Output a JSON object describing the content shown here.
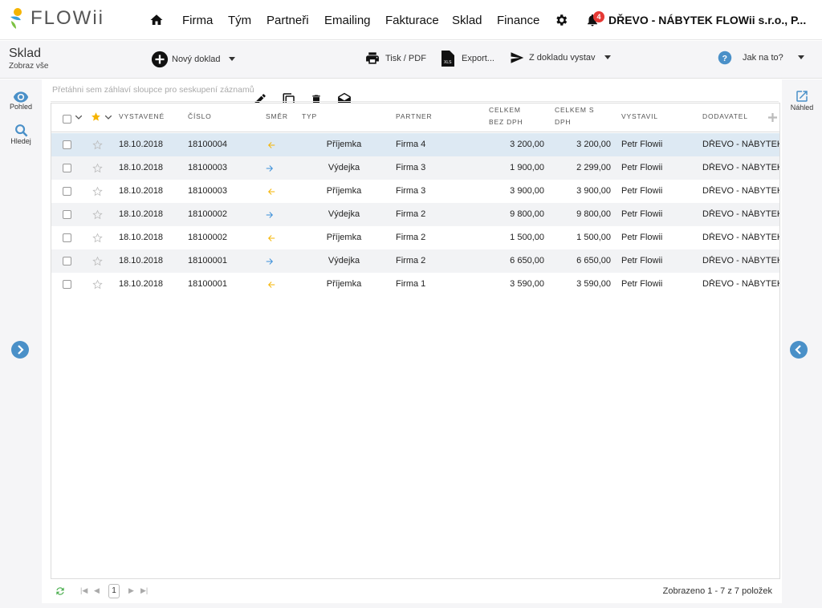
{
  "brand": {
    "name": "FLOWii"
  },
  "nav": {
    "items": [
      "Firma",
      "Tým",
      "Partneři",
      "Emailing",
      "Fakturace",
      "Sklad",
      "Finance"
    ],
    "notification_count": "4",
    "company": "DŘEVO - NÁBYTEK FLOWii s.r.o., P..."
  },
  "page": {
    "title": "Sklad",
    "subtitle": "Zobraz vše"
  },
  "toolbar": {
    "new_doc": "Nový doklad",
    "print": "Tisk / PDF",
    "export": "Export...",
    "from_doc": "Z dokladu vystav",
    "help": "Jak na to?"
  },
  "left_sidebar": {
    "view": "Pohled",
    "search": "Hledej"
  },
  "right_sidebar": {
    "preview": "Náhled"
  },
  "grid": {
    "group_hint": "Přetáhni sem záhlaví sloupce pro seskupení záznamů",
    "columns": {
      "issued": "VYSTAVENÉ",
      "number": "ČÍSLO",
      "direction": "SMĚR",
      "type": "TYP",
      "partner": "PARTNER",
      "total_no_vat_1": "CELKEM",
      "total_no_vat_2": "BEZ DPH",
      "total_vat_1": "CELKEM S",
      "total_vat_2": "DPH",
      "issued_by": "VYSTAVIL",
      "supplier": "DODAVATEL"
    },
    "rows": [
      {
        "date": "18.10.2018",
        "number": "18100004",
        "dir": "in",
        "type": "Příjemka",
        "partner": "Firma 4",
        "total": "3 200,00",
        "total_vat": "3 200,00",
        "by": "Petr Flowii",
        "supplier": "DŘEVO - NÁBYTEK F"
      },
      {
        "date": "18.10.2018",
        "number": "18100003",
        "dir": "out",
        "type": "Výdejka",
        "partner": "Firma 3",
        "total": "1 900,00",
        "total_vat": "2 299,00",
        "by": "Petr Flowii",
        "supplier": "DŘEVO - NÁBYTEK F"
      },
      {
        "date": "18.10.2018",
        "number": "18100003",
        "dir": "in",
        "type": "Příjemka",
        "partner": "Firma 3",
        "total": "3 900,00",
        "total_vat": "3 900,00",
        "by": "Petr Flowii",
        "supplier": "DŘEVO - NÁBYTEK F"
      },
      {
        "date": "18.10.2018",
        "number": "18100002",
        "dir": "out",
        "type": "Výdejka",
        "partner": "Firma 2",
        "total": "9 800,00",
        "total_vat": "9 800,00",
        "by": "Petr Flowii",
        "supplier": "DŘEVO - NÁBYTEK F"
      },
      {
        "date": "18.10.2018",
        "number": "18100002",
        "dir": "in",
        "type": "Příjemka",
        "partner": "Firma 2",
        "total": "1 500,00",
        "total_vat": "1 500,00",
        "by": "Petr Flowii",
        "supplier": "DŘEVO - NÁBYTEK F"
      },
      {
        "date": "18.10.2018",
        "number": "18100001",
        "dir": "out",
        "type": "Výdejka",
        "partner": "Firma 2",
        "total": "6 650,00",
        "total_vat": "6 650,00",
        "by": "Petr Flowii",
        "supplier": "DŘEVO - NÁBYTEK F"
      },
      {
        "date": "18.10.2018",
        "number": "18100001",
        "dir": "in",
        "type": "Příjemka",
        "partner": "Firma 1",
        "total": "3 590,00",
        "total_vat": "3 590,00",
        "by": "Petr Flowii",
        "supplier": "DŘEVO - NÁBYTEK F"
      }
    ]
  },
  "pager": {
    "current_page": "1",
    "summary": "Zobrazeno 1 - 7 z 7 položek"
  },
  "colors": {
    "accent": "#4a90c8",
    "in_arrow": "#f5b400",
    "out_arrow": "#3b8fd9",
    "badge": "#e53935",
    "selected_row": "#dde9f3"
  }
}
